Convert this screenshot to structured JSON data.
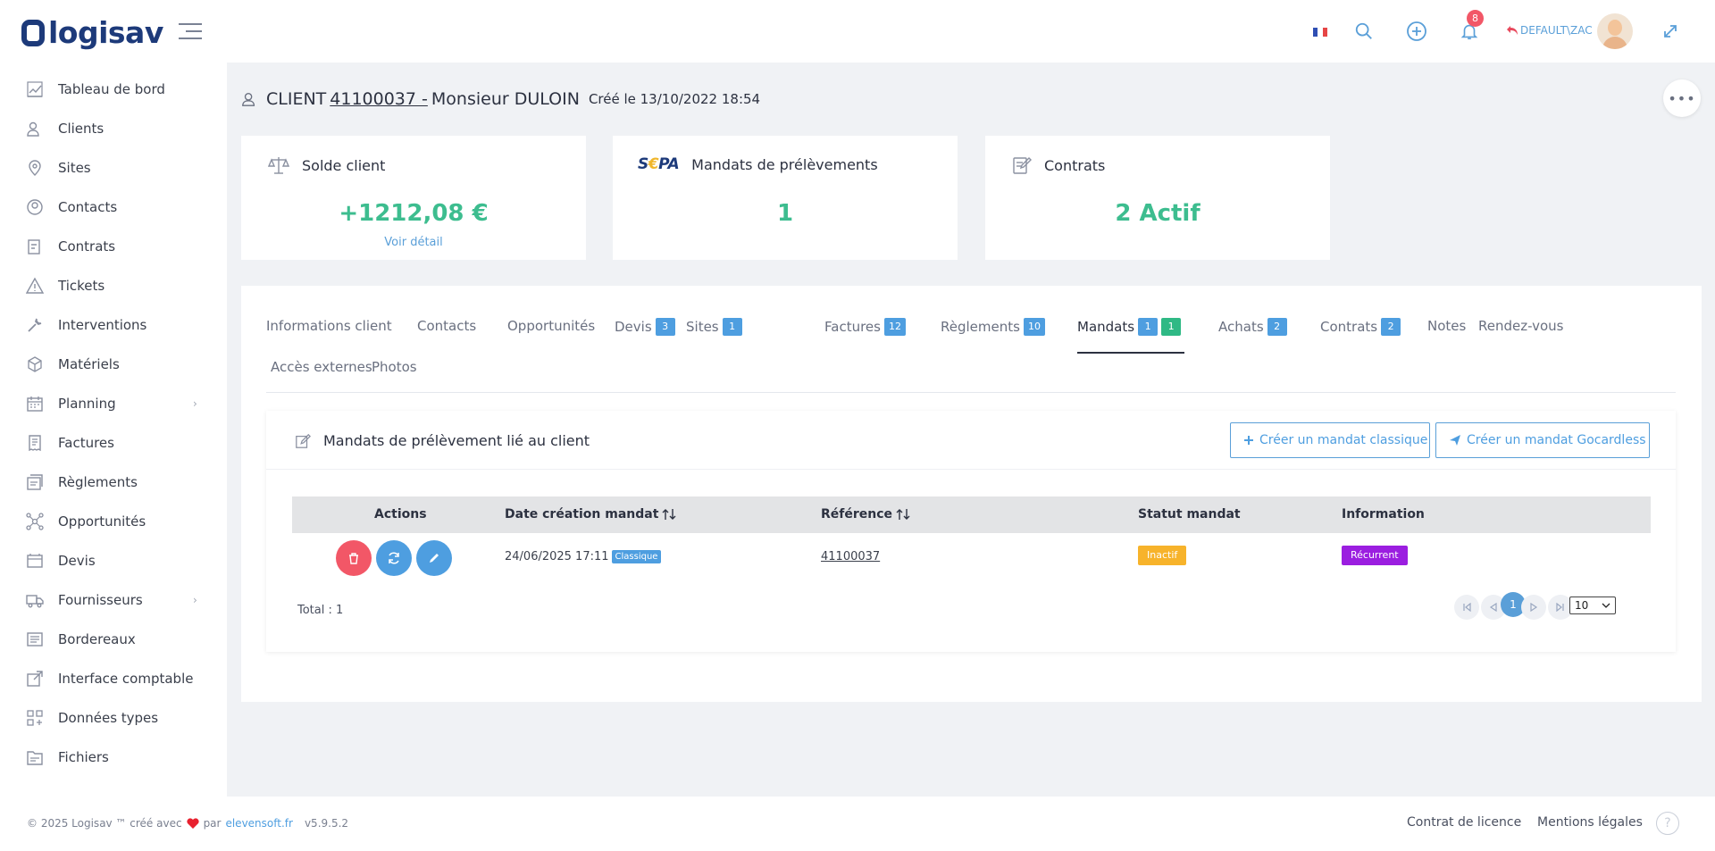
{
  "app": {
    "logo_text": "logisav"
  },
  "header": {
    "notifications_count": "8",
    "user_label": "DEFAULT\\ZAC",
    "colors": {
      "accent": "#5a9fd8",
      "brand": "#1d3a7a",
      "alert": "#f25767"
    }
  },
  "sidebar": {
    "items": [
      {
        "label": "Tableau de bord",
        "icon": "chart-icon"
      },
      {
        "label": "Clients",
        "icon": "users-icon"
      },
      {
        "label": "Sites",
        "icon": "map-pin-icon"
      },
      {
        "label": "Contacts",
        "icon": "contact-icon"
      },
      {
        "label": "Contrats",
        "icon": "contract-icon"
      },
      {
        "label": "Tickets",
        "icon": "warning-icon"
      },
      {
        "label": "Interventions",
        "icon": "wrench-icon"
      },
      {
        "label": "Matériels",
        "icon": "box-icon"
      },
      {
        "label": "Planning",
        "icon": "calendar-icon",
        "has_children": true
      },
      {
        "label": "Factures",
        "icon": "invoice-icon"
      },
      {
        "label": "Règlements",
        "icon": "payment-icon"
      },
      {
        "label": "Opportunités",
        "icon": "network-icon"
      },
      {
        "label": "Devis",
        "icon": "quote-icon"
      },
      {
        "label": "Fournisseurs",
        "icon": "truck-icon",
        "has_children": true
      },
      {
        "label": "Bordereaux",
        "icon": "list-icon"
      },
      {
        "label": "Interface comptable",
        "icon": "external-link-icon"
      },
      {
        "label": "Données types",
        "icon": "grid-icon"
      },
      {
        "label": "Fichiers",
        "icon": "folder-icon"
      }
    ]
  },
  "page": {
    "title_prefix": "CLIENT",
    "client_number": "41100037 -",
    "client_name": "Monsieur DULOIN",
    "created": "Créé le 13/10/2022 18:54"
  },
  "cards": {
    "balance": {
      "title": "Solde client",
      "value": "+1212,08 €",
      "link": "Voir détail"
    },
    "mandates": {
      "title": "Mandats de prélèvements",
      "logo_text": "SEPA",
      "value": "1"
    },
    "contracts": {
      "title": "Contrats",
      "value": "2 Actif"
    }
  },
  "tabs": [
    {
      "label": "Informations client"
    },
    {
      "label": "Contacts"
    },
    {
      "label": "Opportunités"
    },
    {
      "label": "Devis",
      "badge": "3"
    },
    {
      "label": "Sites",
      "badge": "1"
    },
    {
      "label": "Factures",
      "badge": "12"
    },
    {
      "label": "Règlements",
      "badge": "10"
    },
    {
      "label": "Mandats",
      "badge": "1",
      "badge2": "1",
      "active": true
    },
    {
      "label": "Achats",
      "badge": "2"
    },
    {
      "label": "Contrats",
      "badge": "2"
    },
    {
      "label": "Notes"
    },
    {
      "label": "Rendez-vous"
    },
    {
      "label": "Accès externes"
    },
    {
      "label": "Photos"
    }
  ],
  "mandates_section": {
    "title": "Mandats de prélèvement lié au client",
    "btn_classic": "Créer un mandat classique",
    "btn_gocardless": "Créer un mandat Gocardless",
    "columns": {
      "actions": "Actions",
      "date": "Date création mandat",
      "reference": "Référence",
      "status": "Statut mandat",
      "info": "Information"
    },
    "rows": [
      {
        "date": "24/06/2025 17:11",
        "type": "Classique",
        "reference": "41100037",
        "status": "Inactif",
        "info": "Récurrent"
      }
    ],
    "total": "Total : 1",
    "current_page": "1",
    "page_size": "10"
  },
  "footer": {
    "copyright": "© 2025 Logisav ™ créé avec",
    "by": "par",
    "company_link": "elevensoft.fr",
    "version": "v5.9.5.2",
    "license": "Contrat de licence",
    "legal": "Mentions légales",
    "help": "?"
  }
}
